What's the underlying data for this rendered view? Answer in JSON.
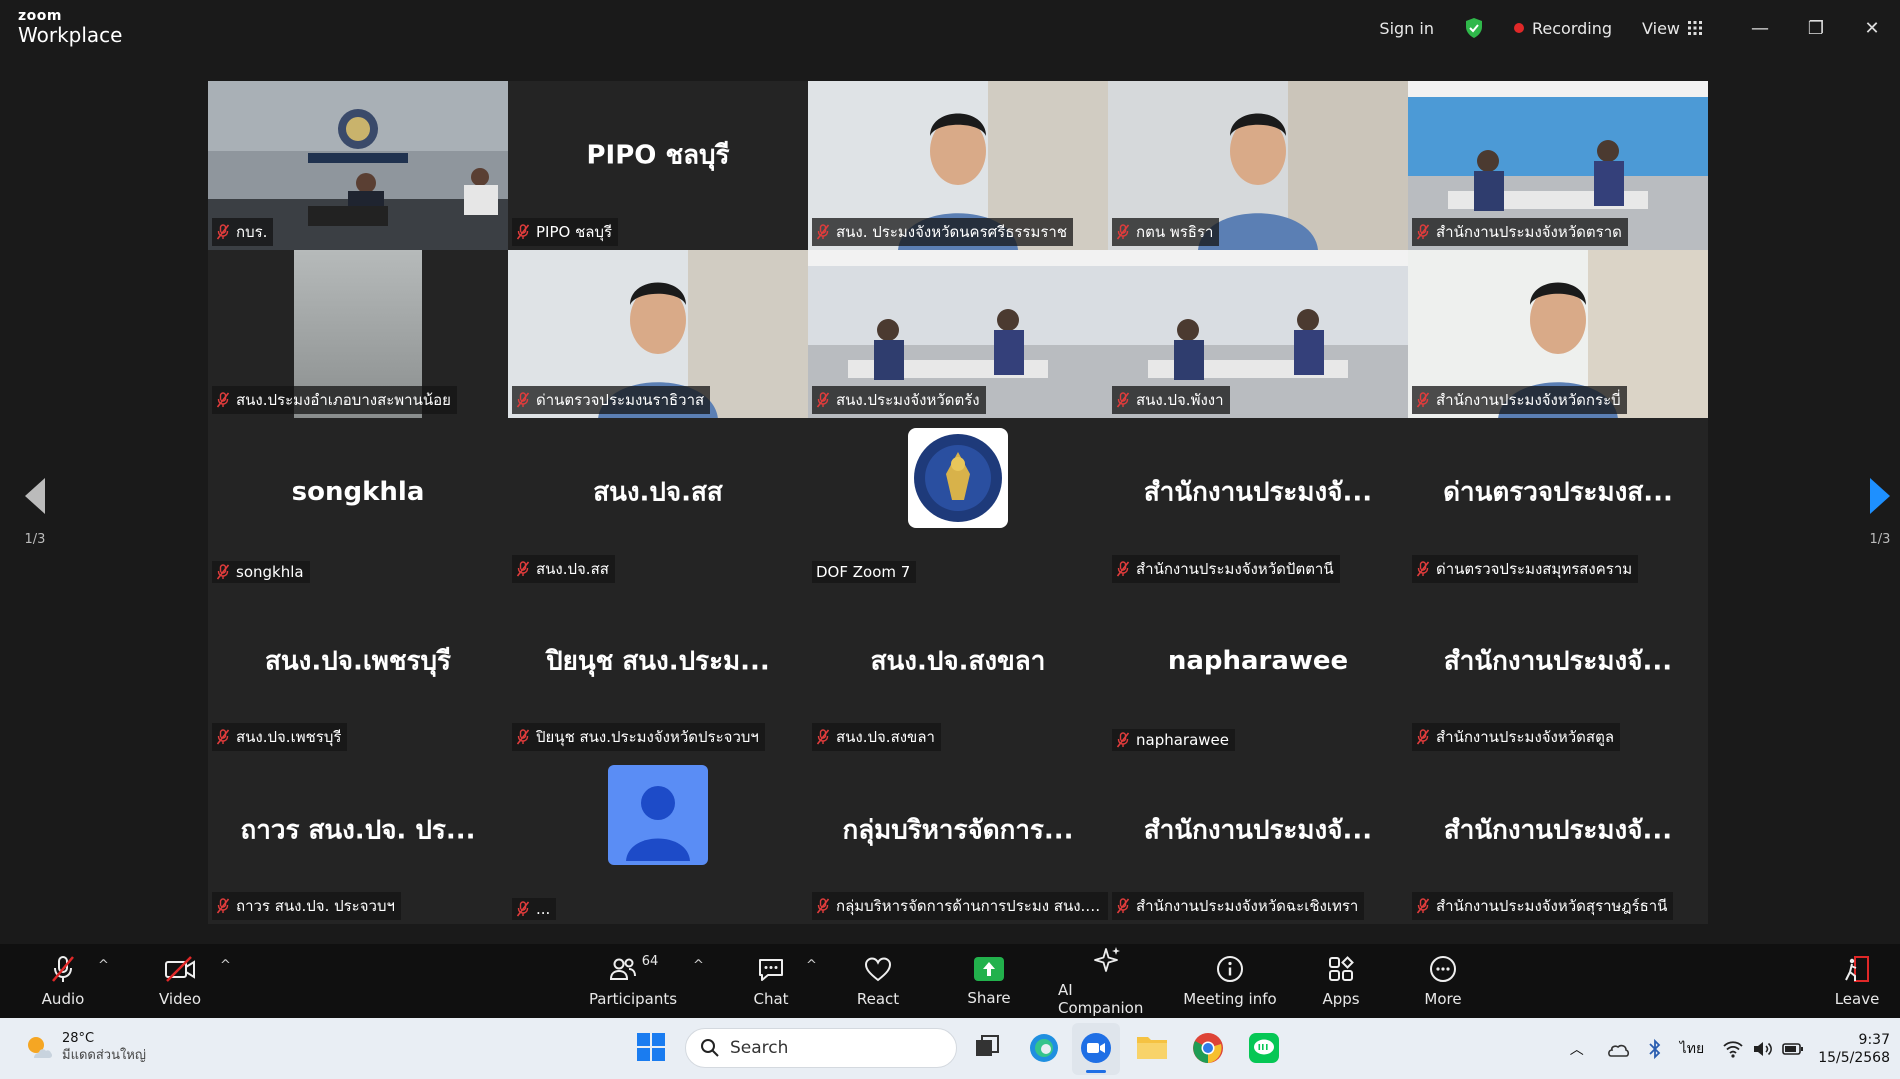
{
  "app": {
    "logo_line1": "zoom",
    "logo_line2": "Workplace"
  },
  "titlebar": {
    "sign_in": "Sign in",
    "recording": "Recording",
    "view": "View"
  },
  "colors": {
    "active_border": "#2fd36b",
    "share_green": "#22b14c",
    "leave_red": "#e02828",
    "page_arrow_blue": "#1e90ff"
  },
  "tiles": [
    {
      "name": "กบร.",
      "display": "",
      "type": "video-room",
      "active": true
    },
    {
      "name": "PIPO ชลบุรี",
      "display": "PIPO ชลบุรี",
      "type": "name"
    },
    {
      "name": "สนง. ประมงจังหวัดนครศรีธรรมราช",
      "display": "",
      "type": "video-person"
    },
    {
      "name": "กตน พรธิรา",
      "display": "",
      "type": "video-person"
    },
    {
      "name": "สำนักงานประมงจังหวัดตราด",
      "display": "",
      "type": "video-office"
    },
    {
      "name": "สนง.ประมงอำเภอบางสะพานน้อย",
      "display": "",
      "type": "video-blank"
    },
    {
      "name": "ด่านตรวจประมงนราธิวาส",
      "display": "",
      "type": "video-person"
    },
    {
      "name": "สนง.ประมงจังหวัดตรัง",
      "display": "",
      "type": "video-office"
    },
    {
      "name": "สนง.ปจ.พังงา",
      "display": "",
      "type": "video-office"
    },
    {
      "name": "สำนักงานประมงจังหวัดกระบี่",
      "display": "",
      "type": "video-person"
    },
    {
      "name": "songkhla",
      "display": "songkhla",
      "type": "name"
    },
    {
      "name": "สนง.ปจ.สส",
      "display": "สนง.ปจ.สส",
      "type": "name"
    },
    {
      "name": "DOF Zoom 7",
      "display": "",
      "type": "logo",
      "muted": false
    },
    {
      "name": "สำนักงานประมงจังหวัดปัตตานี",
      "display": "สำนักงานประมงจั...",
      "type": "name"
    },
    {
      "name": "ด่านตรวจประมงสมุทรสงคราม",
      "display": "ด่านตรวจประมงส...",
      "type": "name"
    },
    {
      "name": "สนง.ปจ.เพชรบุรี",
      "display": "สนง.ปจ.เพชรบุรี",
      "type": "name"
    },
    {
      "name": "ปิยนุช สนง.ประมงจังหวัดประจวบฯ",
      "display": "ปิยนุช สนง.ประม...",
      "type": "name"
    },
    {
      "name": "สนง.ปจ.สงขลา",
      "display": "สนง.ปจ.สงขลา",
      "type": "name"
    },
    {
      "name": "napharawee",
      "display": "napharawee",
      "type": "name"
    },
    {
      "name": "สำนักงานประมงจังหวัดสตูล",
      "display": "สำนักงานประมงจั...",
      "type": "name"
    },
    {
      "name": "ถาวร สนง.ปจ. ประจวบฯ",
      "display": "ถาวร สนง.ปจ. ปร...",
      "type": "name"
    },
    {
      "name": "...",
      "display": "",
      "type": "avatar"
    },
    {
      "name": "กลุ่มบริหารจัดการด้านการประมง สนง.ปจ.ระ...",
      "display": "กลุ่มบริหารจัดการ...",
      "type": "name"
    },
    {
      "name": "สำนักงานประมงจังหวัดฉะเชิงเทรา",
      "display": "สำนักงานประมงจั...",
      "type": "name"
    },
    {
      "name": "สำนักงานประมงจังหวัดสุราษฎร์ธานี",
      "display": "สำนักงานประมงจั...",
      "type": "name"
    }
  ],
  "pagination": {
    "left": "1/3",
    "right": "1/3"
  },
  "toolbar": {
    "audio": "Audio",
    "video": "Video",
    "participants": "Participants",
    "participant_count": "64",
    "chat": "Chat",
    "react": "React",
    "share": "Share",
    "ai_companion": "AI Companion",
    "meeting_info": "Meeting info",
    "apps": "Apps",
    "more": "More",
    "leave": "Leave"
  },
  "taskbar": {
    "weather_temp": "28°C",
    "weather_desc": "มีแดดส่วนใหญ่",
    "search_placeholder": "Search",
    "lang": "ไทย",
    "time": "9:37",
    "date": "15/5/2568"
  }
}
